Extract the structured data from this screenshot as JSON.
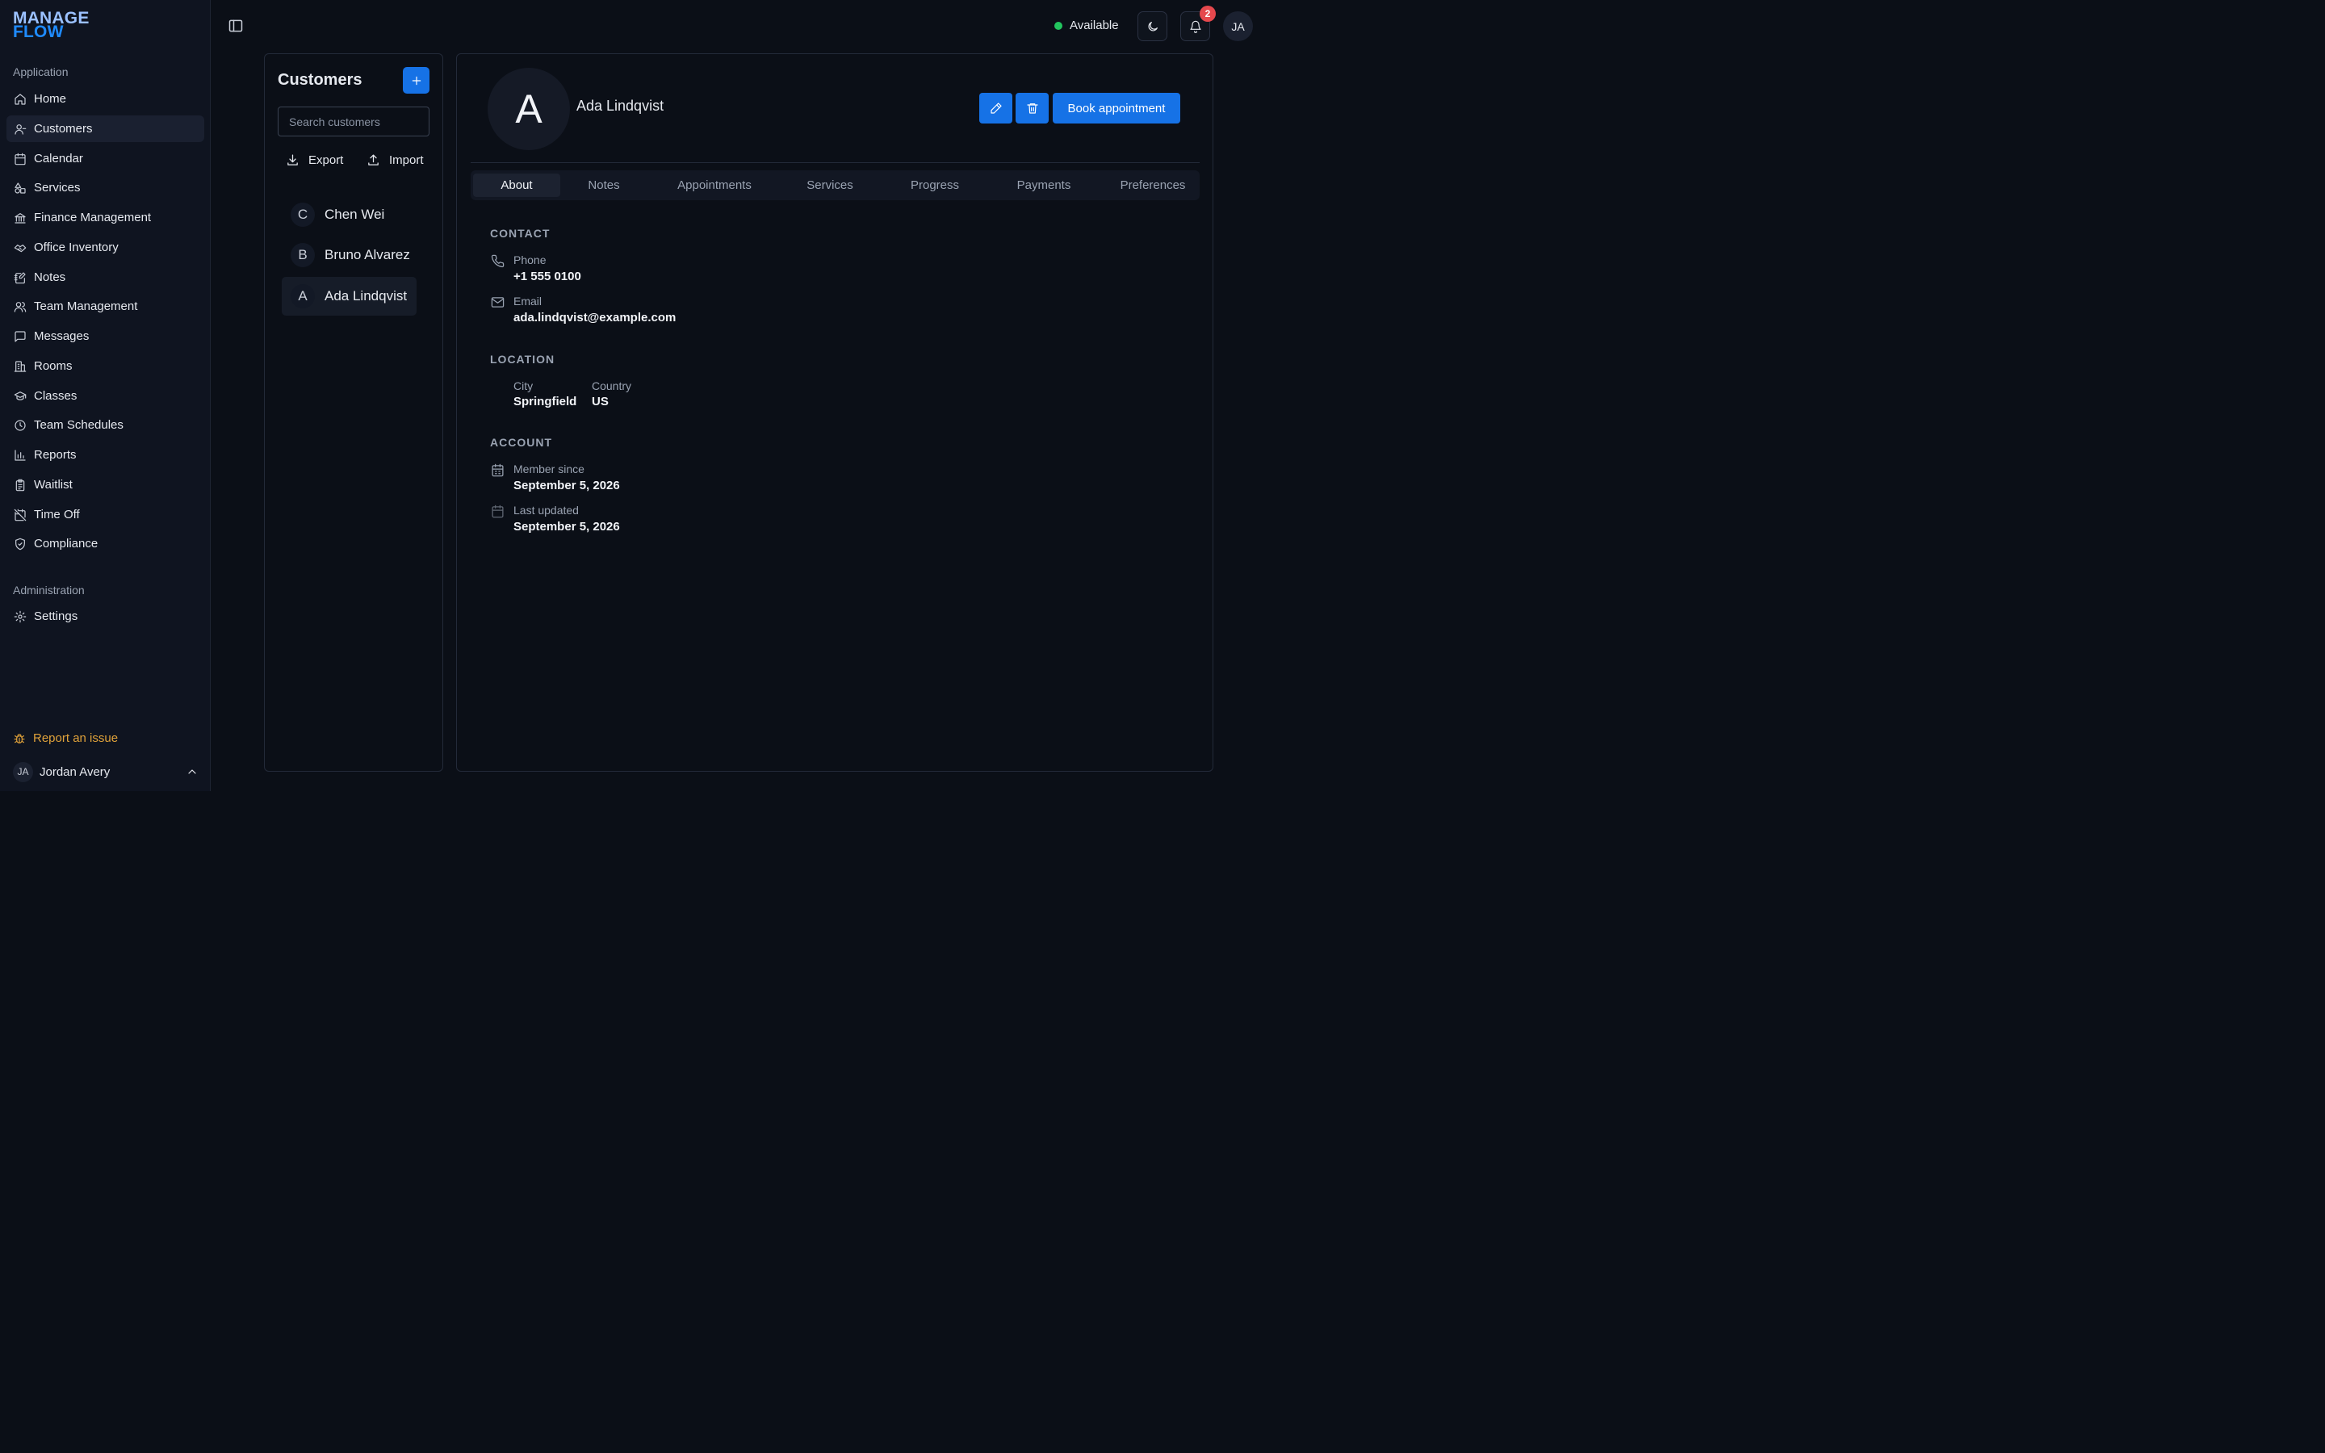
{
  "app": {
    "logo_line1": "MANAGE",
    "logo_line2": "FLOW"
  },
  "sidebar": {
    "application_label": "Application",
    "items": [
      {
        "label": "Home",
        "icon": "home-icon"
      },
      {
        "label": "Customers",
        "icon": "user-icon",
        "active": true
      },
      {
        "label": "Calendar",
        "icon": "calendar-icon"
      },
      {
        "label": "Services",
        "icon": "shapes-icon"
      },
      {
        "label": "Finance Management",
        "icon": "bank-icon"
      },
      {
        "label": "Office Inventory",
        "icon": "handshake-icon"
      },
      {
        "label": "Notes",
        "icon": "notebook-pen-icon"
      },
      {
        "label": "Team Management",
        "icon": "users-icon"
      },
      {
        "label": "Messages",
        "icon": "message-square-icon"
      },
      {
        "label": "Rooms",
        "icon": "building-icon"
      },
      {
        "label": "Classes",
        "icon": "graduation-cap-icon"
      },
      {
        "label": "Team Schedules",
        "icon": "clock-icon"
      },
      {
        "label": "Reports",
        "icon": "bar-chart-icon"
      },
      {
        "label": "Waitlist",
        "icon": "clipboard-list-icon"
      },
      {
        "label": "Time Off",
        "icon": "calendar-off-icon"
      },
      {
        "label": "Compliance",
        "icon": "shield-check-icon"
      }
    ],
    "administration_label": "Administration",
    "admin_items": [
      {
        "label": "Settings",
        "icon": "gear-icon"
      }
    ],
    "report_issue": "Report an issue",
    "user": {
      "initials": "JA",
      "name": "Jordan Avery"
    }
  },
  "topbar": {
    "status": "Available",
    "status_color": "#22c55e",
    "notification_count": "2",
    "avatar_initials": "JA"
  },
  "customers": {
    "title": "Customers",
    "search_placeholder": "Search customers",
    "export_label": "Export",
    "import_label": "Import",
    "list": [
      {
        "initial": "C",
        "name": "Chen Wei"
      },
      {
        "initial": "B",
        "name": "Bruno Alvarez"
      },
      {
        "initial": "A",
        "name": "Ada Lindqvist",
        "active": true
      }
    ]
  },
  "detail": {
    "initial": "A",
    "name": "Ada Lindqvist",
    "book_label": "Book appointment",
    "tabs": [
      "About",
      "Notes",
      "Appointments",
      "Services",
      "Progress",
      "Payments",
      "Preferences"
    ],
    "active_tab": "About",
    "contact": {
      "heading": "CONTACT",
      "phone_label": "Phone",
      "phone_value": "+1 555 0100",
      "email_label": "Email",
      "email_value": "ada.lindqvist@example.com"
    },
    "location": {
      "heading": "LOCATION",
      "city_label": "City",
      "city_value": "Springfield",
      "country_label": "Country",
      "country_value": "US"
    },
    "account": {
      "heading": "ACCOUNT",
      "member_label": "Member since",
      "member_value": "September 5, 2026",
      "updated_label": "Last updated",
      "updated_value": "September 5, 2026"
    }
  },
  "colors": {
    "accent": "#1672e6",
    "warning": "#e0a23a",
    "badge": "#e5484d"
  }
}
